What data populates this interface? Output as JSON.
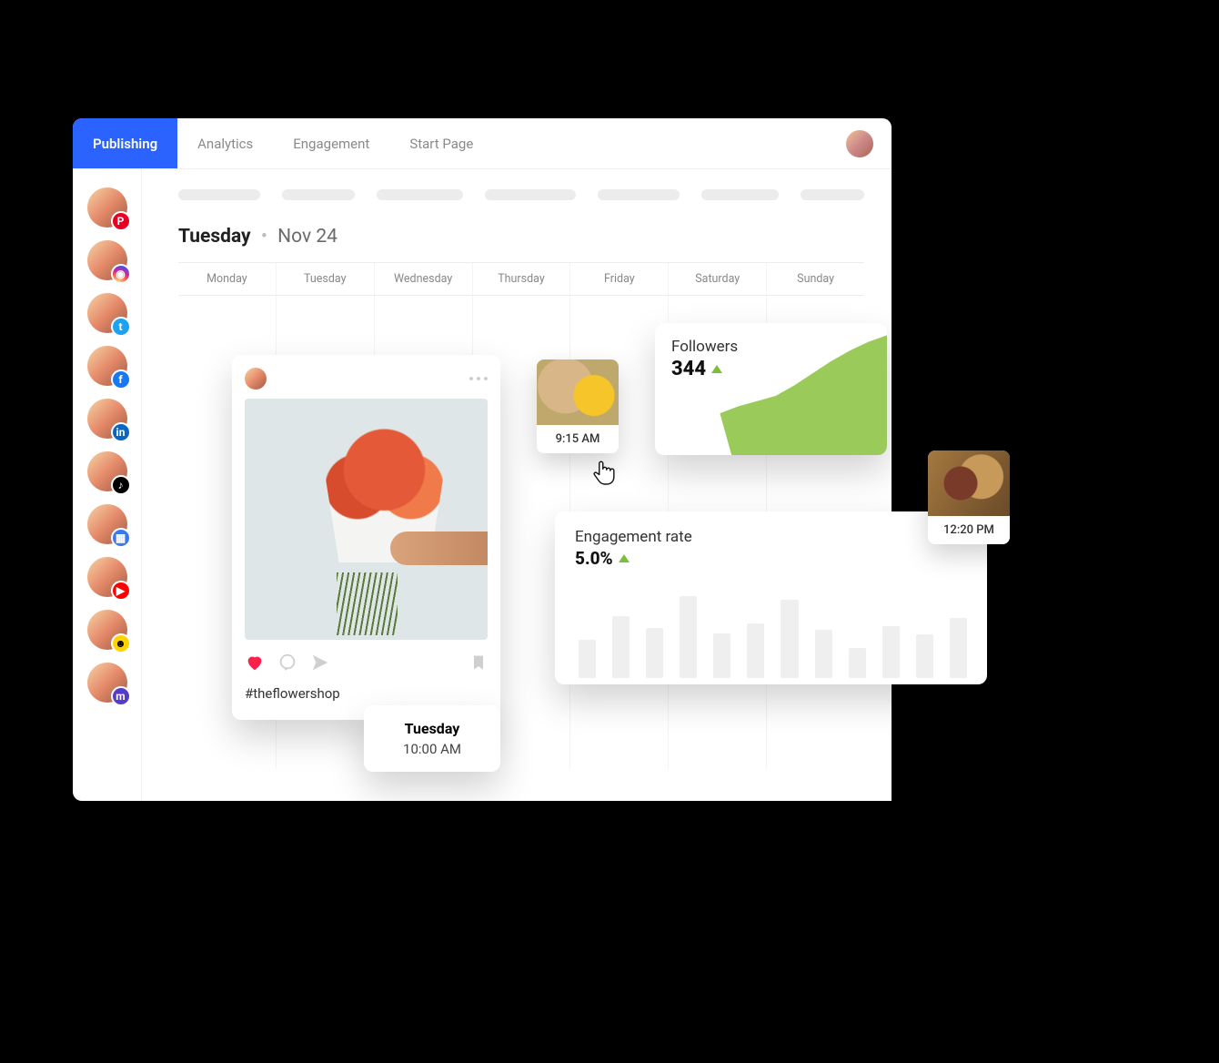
{
  "tabs": {
    "publishing": "Publishing",
    "analytics": "Analytics",
    "engagement": "Engagement",
    "start_page": "Start Page"
  },
  "sidebar_networks": [
    "pinterest",
    "instagram",
    "twitter",
    "facebook",
    "linkedin",
    "tiktok",
    "gmb",
    "youtube",
    "snapchat",
    "mastodon"
  ],
  "date_heading": {
    "dayname": "Tuesday",
    "monthday": "Nov 24"
  },
  "days": [
    "Monday",
    "Tuesday",
    "Wednesday",
    "Thursday",
    "Friday",
    "Saturday",
    "Sunday"
  ],
  "post": {
    "caption": "#theflowershop"
  },
  "schedule": {
    "day": "Tuesday",
    "time": "10:00 AM"
  },
  "thumb1": {
    "time": "9:15 AM"
  },
  "thumb2": {
    "time": "12:20 PM"
  },
  "followers": {
    "label": "Followers",
    "value": "344"
  },
  "engagement": {
    "label": "Engagement rate",
    "value": "5.0%"
  },
  "chart_data": [
    {
      "type": "area",
      "title": "Followers",
      "value_label": "344",
      "trend": "up",
      "x": [
        0,
        1,
        2,
        3,
        4,
        5,
        6,
        7,
        8,
        9
      ],
      "values": [
        120,
        140,
        155,
        170,
        200,
        235,
        270,
        300,
        325,
        344
      ],
      "ylim": [
        0,
        360
      ]
    },
    {
      "type": "bar",
      "title": "Engagement rate",
      "value_label": "5.0%",
      "trend": "up",
      "categories": [
        "",
        "",
        "",
        "",
        "",
        "",
        "",
        "",
        "",
        "",
        "",
        ""
      ],
      "values": [
        38,
        62,
        50,
        82,
        45,
        55,
        78,
        48,
        30,
        52,
        44,
        60
      ],
      "ylim": [
        0,
        100
      ]
    }
  ]
}
